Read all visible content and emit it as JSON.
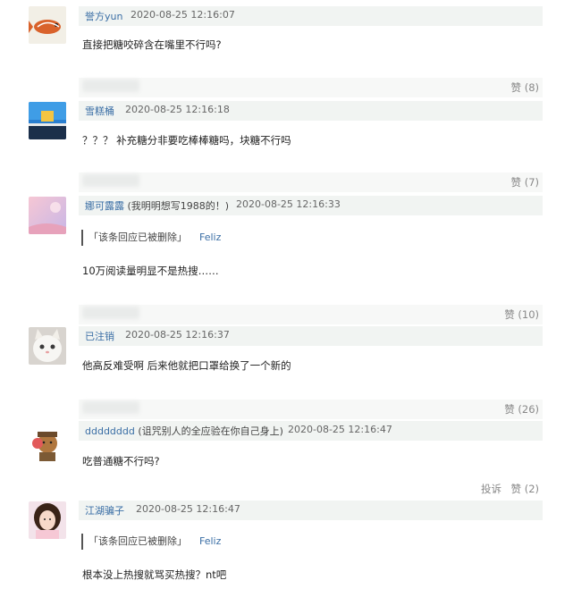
{
  "comments": [
    {
      "username": "誉方yun",
      "note": "",
      "time": "2020-08-25 12:16:07",
      "text": "直接把糖咬碎含在嘴里不行吗?",
      "quote": null,
      "likes": "赞 (8)",
      "report": ""
    },
    {
      "username": "雪糕桶",
      "note": "",
      "time": "2020-08-25 12:16:18",
      "text": "？？？ 补充糖分非要吃棒棒糖吗，块糖不行吗",
      "quote": null,
      "likes": "赞 (7)",
      "report": ""
    },
    {
      "username": "娜可露露",
      "note": "(我明明想写1988的！)",
      "time": "2020-08-25 12:16:33",
      "text": "10万阅读量明显不是热搜……",
      "quote": {
        "text": "「该条回应已被删除」",
        "author": "Feliz"
      },
      "likes": "赞 (10)",
      "report": ""
    },
    {
      "username": "已注销",
      "note": "",
      "time": "2020-08-25 12:16:37",
      "text": "他高反难受啊 后来他就把口罩给换了一个新的",
      "quote": null,
      "likes": "赞 (26)",
      "report": ""
    },
    {
      "username": "dddddddd",
      "note": "(诅咒别人的全应验在你自己身上)",
      "time": "2020-08-25 12:16:47",
      "text": "吃普通糖不行吗?",
      "quote": null,
      "likes": "赞 (2)",
      "report": "投诉"
    },
    {
      "username": "江湖骗子",
      "note": "",
      "time": "2020-08-25 12:16:47",
      "text": "根本没上热搜就骂买热搜？nt吧",
      "quote": {
        "text": "「该条回应已被删除」",
        "author": "Feliz"
      },
      "likes": "",
      "report": ""
    }
  ]
}
